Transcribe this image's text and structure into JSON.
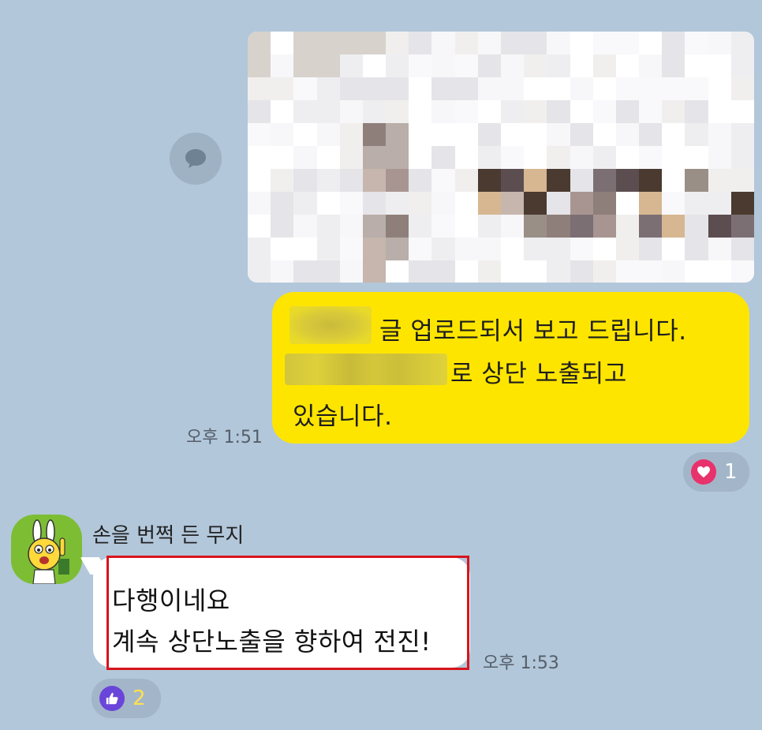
{
  "chat": {
    "message_me": {
      "line1": "글 업로드되서 보고 드립니다.",
      "line2": "로 상단 노출되고",
      "line3": "있습니다.",
      "time": "오후 1:51",
      "reaction_count": "1"
    },
    "message_them": {
      "sender": "손을 번쩍 든 무지",
      "line1": "다행이네요",
      "line2": "계속 상단노출을 향하여 전진!",
      "time": "오후 1:53",
      "reaction_count": "2"
    }
  },
  "colors": {
    "background": "#b2c7da",
    "my_bubble": "#fee500",
    "their_bubble": "#ffffff",
    "highlight_border": "#d9141c",
    "heart": "#e8326b",
    "like": "#6a45d9"
  },
  "icons": {
    "share": "share-bubble-icon",
    "heart": "heart-icon",
    "like": "thumbs-up-icon",
    "avatar": "muzi-avatar-icon"
  }
}
